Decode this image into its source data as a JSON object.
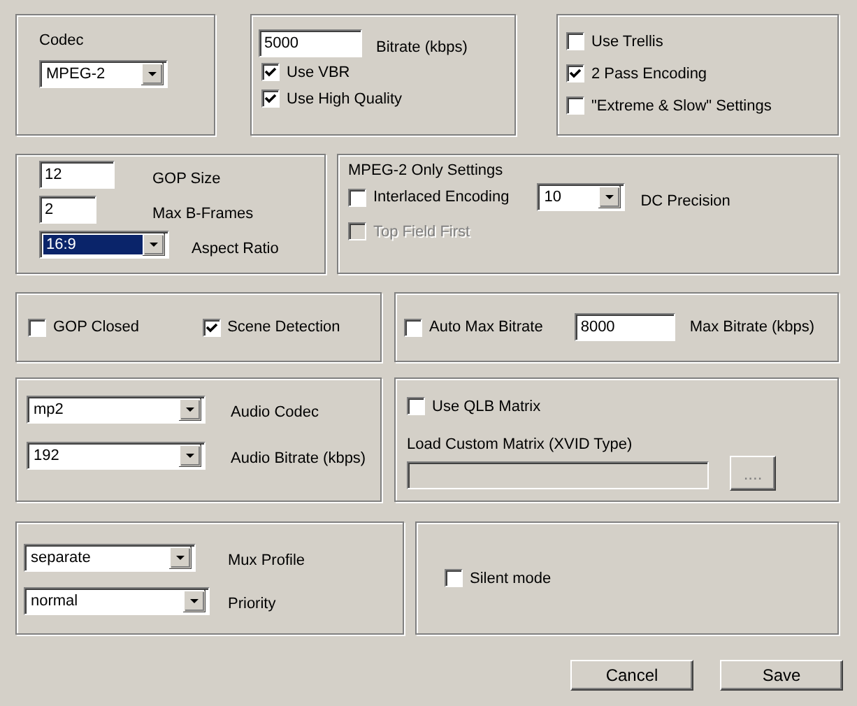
{
  "panels": [
    {
      "rows": [
        [
          {
            "kind": "label",
            "text": "Codec"
          }
        ],
        [
          {
            "kind": "combo",
            "value": "MPEG-2",
            "focused": false
          }
        ]
      ]
    },
    {
      "rows": [
        [
          {
            "kind": "textbox",
            "value": "5000",
            "disabled": false
          },
          {
            "kind": "label",
            "text": "Bitrate (kbps)"
          }
        ],
        [
          {
            "kind": "checkbox",
            "text": "Use VBR",
            "checked": true,
            "disabled": false
          }
        ],
        [
          {
            "kind": "checkbox",
            "text": "Use High Quality",
            "checked": true,
            "disabled": false
          }
        ]
      ]
    },
    {
      "rows": [
        [
          {
            "kind": "checkbox",
            "text": "Use Trellis",
            "checked": false,
            "disabled": false
          }
        ],
        [
          {
            "kind": "checkbox",
            "text": "2 Pass Encoding",
            "checked": true,
            "disabled": false
          }
        ],
        [
          {
            "kind": "checkbox",
            "text": "\"Extreme & Slow\" Settings",
            "checked": false,
            "disabled": false
          }
        ]
      ]
    },
    {
      "rows": [
        [
          {
            "kind": "textbox",
            "value": "12",
            "disabled": false
          },
          {
            "kind": "label",
            "text": "GOP Size"
          }
        ],
        [
          {
            "kind": "textbox",
            "value": "2",
            "disabled": false
          },
          {
            "kind": "label",
            "text": "Max B-Frames"
          }
        ],
        [
          {
            "kind": "combo",
            "value": "16:9",
            "focused": true
          },
          {
            "kind": "label",
            "text": "Aspect Ratio"
          }
        ]
      ]
    },
    {
      "rows": [
        [
          {
            "kind": "label",
            "text": "MPEG-2 Only Settings"
          }
        ],
        [
          {
            "kind": "checkbox",
            "text": "Interlaced Encoding",
            "checked": false,
            "disabled": false
          },
          {
            "kind": "combo",
            "value": "10",
            "focused": false
          },
          {
            "kind": "label",
            "text": "DC Precision"
          }
        ],
        [
          {
            "kind": "checkbox",
            "text": "Top Field First",
            "checked": false,
            "disabled": true
          }
        ]
      ]
    },
    {
      "rows": [
        [
          {
            "kind": "checkbox",
            "text": "GOP Closed",
            "checked": false,
            "disabled": false
          },
          {
            "kind": "checkbox",
            "text": "Scene Detection",
            "checked": true,
            "disabled": false
          }
        ]
      ]
    },
    {
      "rows": [
        [
          {
            "kind": "checkbox",
            "text": "Auto Max Bitrate",
            "checked": false,
            "disabled": false
          },
          {
            "kind": "textbox",
            "value": "8000",
            "disabled": false
          },
          {
            "kind": "label",
            "text": "Max Bitrate (kbps)"
          }
        ]
      ]
    },
    {
      "rows": [
        [
          {
            "kind": "combo",
            "value": "mp2",
            "focused": false
          },
          {
            "kind": "label",
            "text": "Audio Codec"
          }
        ],
        [
          {
            "kind": "combo",
            "value": "192",
            "focused": false
          },
          {
            "kind": "label",
            "text": "Audio Bitrate (kbps)"
          }
        ]
      ]
    },
    {
      "rows": [
        [
          {
            "kind": "checkbox",
            "text": "Use QLB Matrix",
            "checked": false,
            "disabled": false
          }
        ],
        [
          {
            "kind": "label",
            "text": "Load Custom Matrix (XVID Type)"
          }
        ],
        [
          {
            "kind": "textbox",
            "disabled": true
          },
          {
            "kind": "button",
            "text": "...."
          }
        ]
      ]
    },
    {
      "rows": [
        [
          {
            "kind": "combo",
            "value": "separate",
            "focused": false
          },
          {
            "kind": "label",
            "text": "Mux Profile"
          }
        ],
        [
          {
            "kind": "combo",
            "value": "normal",
            "focused": false
          },
          {
            "kind": "label",
            "text": "Priority"
          }
        ]
      ]
    },
    {
      "rows": [
        [
          {
            "kind": "checkbox",
            "text": "Silent mode",
            "checked": false,
            "disabled": false
          }
        ]
      ]
    }
  ],
  "buttons": [
    "Cancel",
    "Save"
  ]
}
